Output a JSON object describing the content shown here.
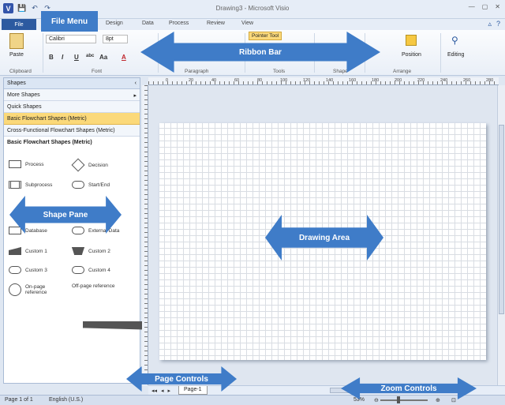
{
  "window": {
    "title": "Drawing3 - Microsoft Visio",
    "controls": [
      "—",
      "▢",
      "✕"
    ]
  },
  "qat": {
    "app_letter": "V",
    "save": "💾",
    "undo": "↶",
    "redo": "↷"
  },
  "tabs": {
    "file": "File",
    "items": [
      "Design",
      "Data",
      "Process",
      "Review",
      "View"
    ]
  },
  "ribbon": {
    "paste": "Paste",
    "font_name": "Calibri",
    "font_size": "8pt",
    "format_buttons": [
      "B",
      "I",
      "U",
      "abc",
      "Aa",
      "A"
    ],
    "pointer_tool": "Pointer Tool",
    "position": "Position",
    "editing": "Editing",
    "groups": [
      "Clipboard",
      "Font",
      "Paragraph",
      "Tools",
      "Shape",
      "Arrange"
    ]
  },
  "shapes_pane": {
    "header": "Shapes",
    "stencils": [
      "More Shapes",
      "Quick Shapes",
      "Basic Flowchart Shapes (Metric)",
      "Cross-Functional Flowchart Shapes (Metric)"
    ],
    "active_index": 2,
    "stencil_title": "Basic Flowchart Shapes (Metric)",
    "shapes": [
      {
        "label": "Process",
        "icon": "rect"
      },
      {
        "label": "Decision",
        "icon": "diamond"
      },
      {
        "label": "Subprocess",
        "icon": "double"
      },
      {
        "label": "Start/End",
        "icon": "round"
      },
      {
        "label": "Database",
        "icon": "rect"
      },
      {
        "label": "External Data",
        "icon": "round"
      },
      {
        "label": "Custom 1",
        "icon": "slant"
      },
      {
        "label": "Custom 2",
        "icon": "trap"
      },
      {
        "label": "Custom 3",
        "icon": "round"
      },
      {
        "label": "Custom 4",
        "icon": "round"
      },
      {
        "label": "On-page reference",
        "icon": "circle"
      },
      {
        "label": "Off-page reference",
        "icon": "page"
      }
    ]
  },
  "ruler": {
    "top_numbers": [
      "0",
      "20",
      "40",
      "60",
      "80",
      "100",
      "120",
      "140",
      "160",
      "180",
      "200",
      "220",
      "240",
      "260",
      "280"
    ]
  },
  "page_controls": {
    "page_tab": "Page-1",
    "nav": [
      "◂◂",
      "◂",
      "▸",
      "▸▸"
    ]
  },
  "status": {
    "page": "Page 1 of 1",
    "language": "English (U.S.)",
    "zoom": "53%"
  },
  "callouts": {
    "file_menu": "File Menu",
    "ribbon_bar": "Ribbon Bar",
    "shape_pane": "Shape Pane",
    "drawing_area": "Drawing Area",
    "page_controls": "Page Controls",
    "zoom_controls": "Zoom Controls"
  },
  "colors": {
    "accent": "#3f7cc8",
    "file_tab": "#2c5aa0",
    "active_stencil": "#fbd97a"
  }
}
